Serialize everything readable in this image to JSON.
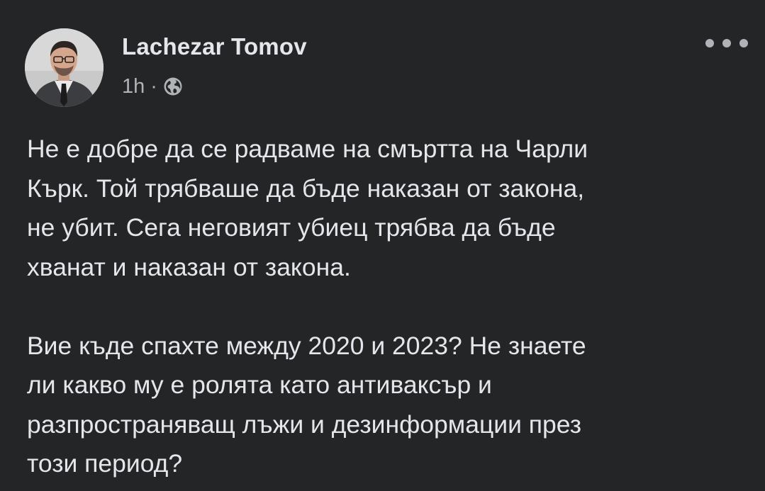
{
  "post": {
    "author": "Lachezar Tomov",
    "time": "1h",
    "separator": "·",
    "privacy_icon": "globe-icon",
    "more_icon": "more-options-icon",
    "paragraphs": [
      {
        "lines": [
          "Не е добре да се радваме на смъртта на Чарли",
          "Кърк. Той трябваше да бъде наказан от закона,",
          "не убит. Сега неговият убиец трябва да бъде",
          "хванат и наказан от закона."
        ]
      },
      {
        "lines": [
          "Вие къде спахте между 2020 и 2023? Не знаете",
          "ли какво му е ролята като антиваксър и",
          "разпространяващ лъжи и дезинформации през",
          "този период?"
        ]
      }
    ]
  },
  "colors": {
    "background": "#242526",
    "primary_text": "#e4e6eb",
    "secondary_text": "#b0b3b8"
  }
}
